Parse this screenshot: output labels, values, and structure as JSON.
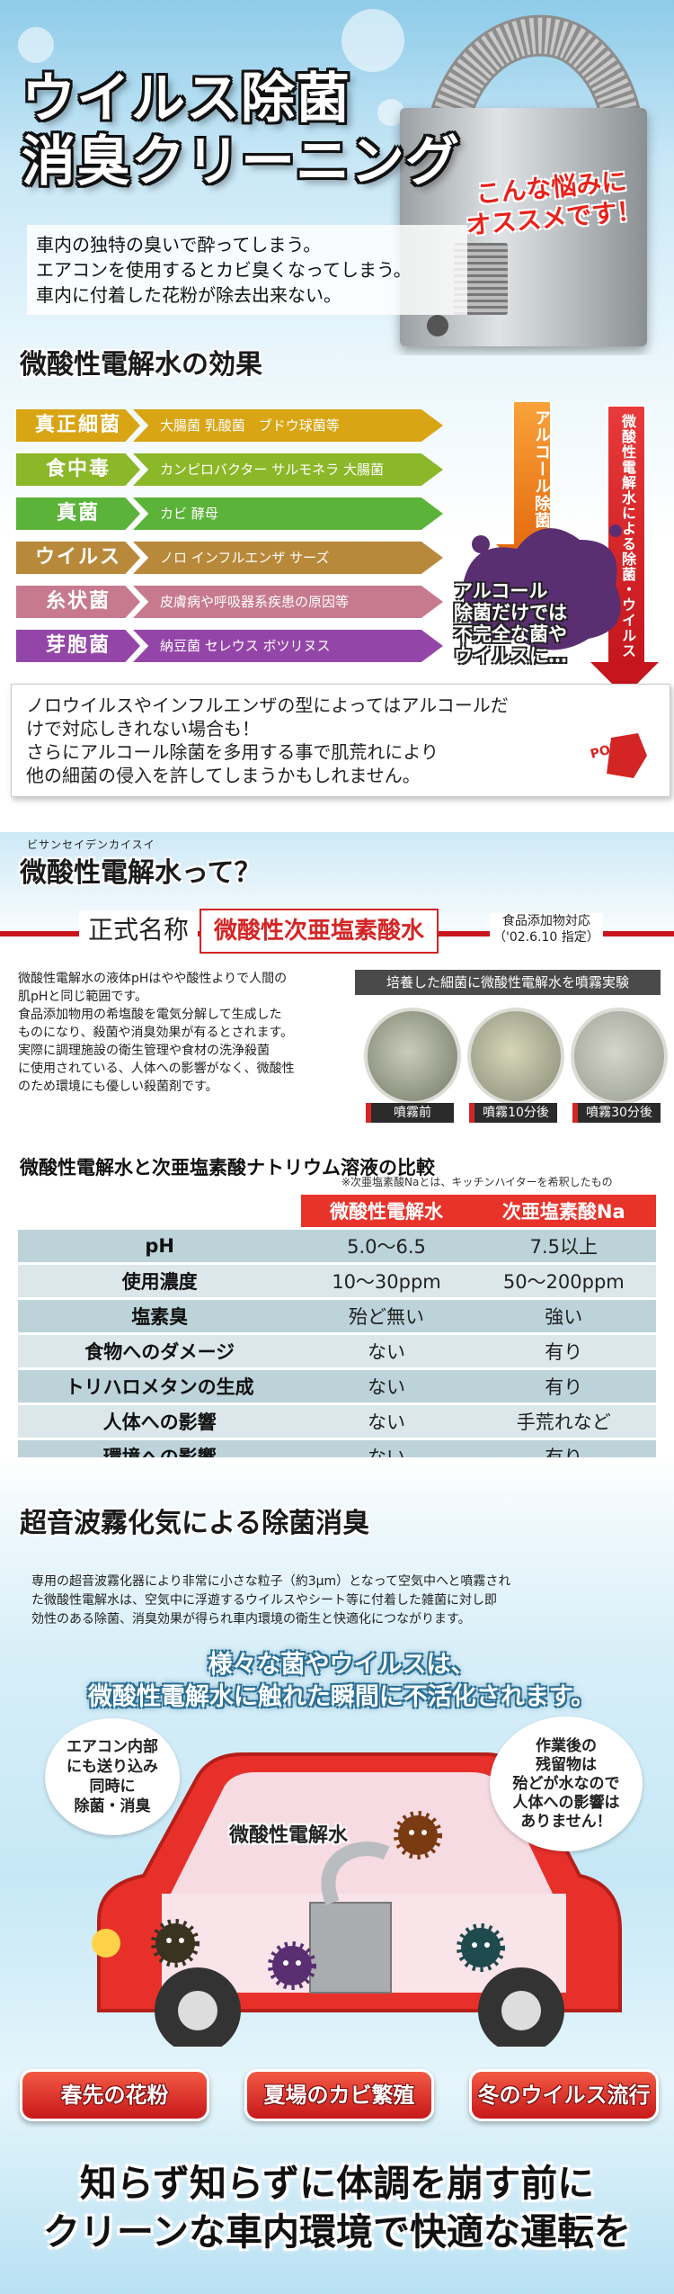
{
  "hero": {
    "title_line1": "ウイルス除菌",
    "title_line2": "消臭クリーニング",
    "recommend_line1": "こんな悩みに",
    "recommend_line2": "オススメです！",
    "worries": [
      "車内の独特の臭いで酔ってしまう。",
      "エアコンを使用するとカビ臭くなってしまう。",
      "車内に付着した花粉が除去出来ない。"
    ]
  },
  "effects": {
    "heading": "微酸性電解水の効果",
    "rows": [
      {
        "category": "真正細菌",
        "examples": "大腸菌 乳酸菌　ブドウ球菌等",
        "color": "#d9a514"
      },
      {
        "category": "食中毒",
        "examples": "カンピロバクター サルモネラ 大腸菌",
        "color": "#8cb728"
      },
      {
        "category": "真菌",
        "examples": "カビ 酵母",
        "color": "#5bb33a"
      },
      {
        "category": "ウイルス",
        "examples": "ノロ インフルエンザ サーズ",
        "color": "#b8893a"
      },
      {
        "category": "糸状菌",
        "examples": "皮膚病や呼吸器系疾患の原因等",
        "color": "#c77a8e"
      },
      {
        "category": "芽胞菌",
        "examples": "納豆菌 セレウス ボツリヌス",
        "color": "#9446a8"
      }
    ],
    "alcohol_arrow": "アルコール除菌",
    "acid_arrow": "微酸性電解水による除菌・ウイルス",
    "alcohol_note": [
      "アルコール",
      "除菌だけでは",
      "不完全な菌や",
      "ウイルスに…"
    ],
    "point_text": [
      "ノロウイルスやインフルエンザの型によってはアルコールだ",
      "けで対応しきれない場合も！",
      "さらにアルコール除菌を多用する事で肌荒れにより",
      "他の細菌の侵入を許してしまうかもしれません。"
    ],
    "point_badge": "POINT"
  },
  "water": {
    "ruby": "ビサンセイデンカイスイ",
    "heading": "微酸性電解水って？",
    "official_label": "正式名称",
    "official_name": "微酸性次亜塩素酸水",
    "food_additive_line1": "食品添加物対応",
    "food_additive_line2": "（'02.6.10 指定）",
    "description": [
      "微酸性電解水の液体pHはやや酸性よりで人間の",
      "肌pHと同じ範囲です。",
      "食品添加物用の希塩酸を電気分解して生成した",
      "ものになり、殺菌や消臭効果が有るとされます。",
      "実際に調理施設の衛生管理や食材の洗浄殺菌",
      "に使用されている、人体への影響がなく、微酸性",
      "のため環境にも優しい殺菌剤です。"
    ],
    "experiment_title": "培養した細菌に微酸性電解水を噴霧実験",
    "experiment_labels": [
      "噴霧前",
      "噴霧10分後",
      "噴霧30分後"
    ]
  },
  "comparison": {
    "title": "微酸性電解水と次亜塩素酸ナトリウム溶液の比較",
    "note": "※次亜塩素酸Naとは、キッチンハイターを希釈したもの",
    "headers": [
      "",
      "微酸性電解水",
      "次亜塩素酸Na"
    ],
    "rows": [
      [
        "pH",
        "5.0〜6.5",
        "7.5以上"
      ],
      [
        "使用濃度",
        "10〜30ppm",
        "50〜200ppm"
      ],
      [
        "塩素臭",
        "殆ど無い",
        "強い"
      ],
      [
        "食物へのダメージ",
        "ない",
        "有り"
      ],
      [
        "トリハロメタンの生成",
        "ない",
        "有り"
      ],
      [
        "人体への影響",
        "ない",
        "手荒れなど"
      ],
      [
        "環境への影響",
        "ない",
        "有り"
      ]
    ]
  },
  "ultrasonic": {
    "heading": "超音波霧化気による除菌消臭",
    "description": [
      "専用の超音波霧化器により非常に小さな粒子（約3μm）となって空気中へと噴霧され",
      "た微酸性電解水は、空気中に浮遊するウイルスやシート等に付着した雑菌に対し即",
      "効性のある除菌、消臭効果が得られ車内環境の衛生と快適化につながります。"
    ],
    "message_line1": "様々な菌やウイルスは、",
    "message_line2": "微酸性電解水に触れた瞬間に不活化されます。",
    "note_aircon": [
      "エアコン内部",
      "にも送り込み",
      "同時に",
      "除菌・消臭"
    ],
    "note_residue": [
      "作業後の",
      "残留物は",
      "殆どが水なので",
      "人体への影響は",
      "ありません！"
    ],
    "car_label": "微酸性電解水",
    "seasons": [
      "春先の花粉",
      "夏場のカビ繁殖",
      "冬のウイルス流行"
    ],
    "closing_line1": "知らず知らずに体調を崩す前に",
    "closing_line2": "クリーンな車内環境で快適な運転を"
  },
  "colors": {
    "accent_red": "#d42525",
    "table_header": "#e8332a",
    "car_body": "#e8302a"
  }
}
